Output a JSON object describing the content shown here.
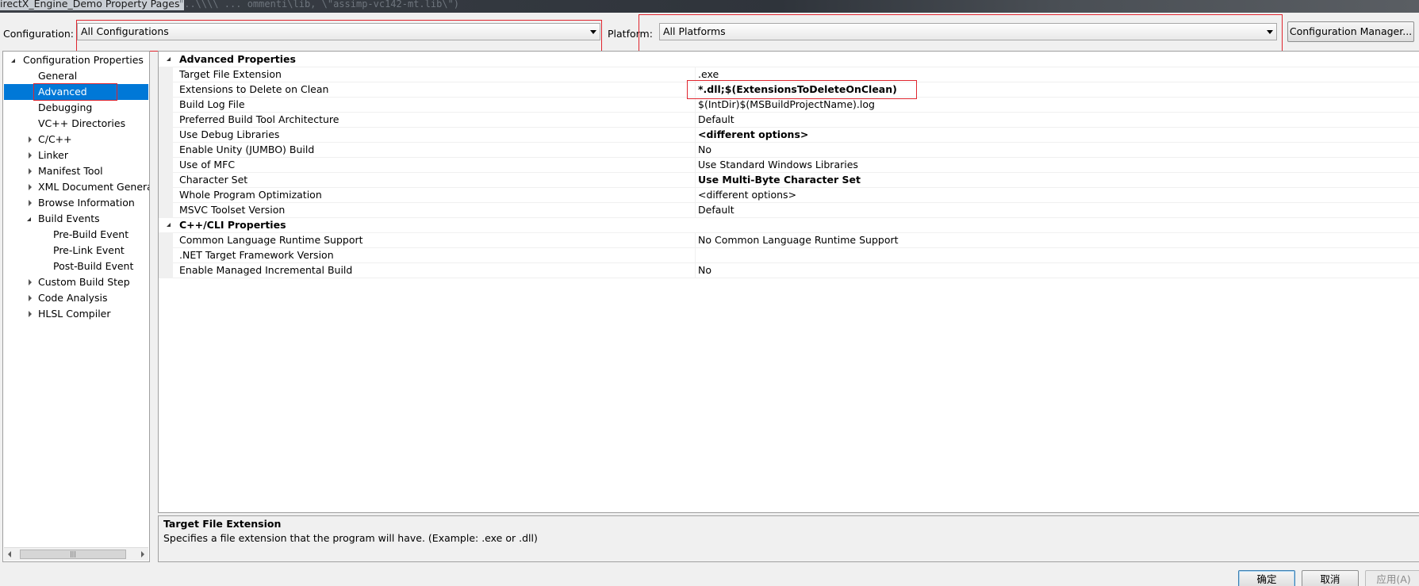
{
  "window": {
    "title": "irectX_Engine_Demo Property Pages",
    "ghost_text": "\"..\\\\\\\\ ... ommenti\\lib, \\\"assimp-vc142-mt.lib\\\")"
  },
  "toolbar": {
    "configuration_label": "Configuration:",
    "configuration_value": "All Configurations",
    "platform_label": "Platform:",
    "platform_value": "All Platforms",
    "config_manager_label": "Configuration Manager..."
  },
  "tree": {
    "items": [
      {
        "label": "Configuration Properties",
        "expander": "open"
      },
      {
        "label": "General",
        "expander": "none"
      },
      {
        "label": "Advanced",
        "expander": "none",
        "selected": true
      },
      {
        "label": "Debugging",
        "expander": "none"
      },
      {
        "label": "VC++ Directories",
        "expander": "none"
      },
      {
        "label": "C/C++",
        "expander": "closed"
      },
      {
        "label": "Linker",
        "expander": "closed"
      },
      {
        "label": "Manifest Tool",
        "expander": "closed"
      },
      {
        "label": "XML Document Generat",
        "expander": "closed"
      },
      {
        "label": "Browse Information",
        "expander": "closed"
      },
      {
        "label": "Build Events",
        "expander": "open"
      },
      {
        "label": "Pre-Build Event",
        "expander": "none"
      },
      {
        "label": "Pre-Link Event",
        "expander": "none"
      },
      {
        "label": "Post-Build Event",
        "expander": "none"
      },
      {
        "label": "Custom Build Step",
        "expander": "closed"
      },
      {
        "label": "Code Analysis",
        "expander": "closed"
      },
      {
        "label": "HLSL Compiler",
        "expander": "closed"
      }
    ],
    "scroll_thumb_glyph": "|||"
  },
  "grid": {
    "categories": [
      {
        "name": "Advanced Properties",
        "rows": [
          {
            "name": "Target File Extension",
            "value": ".exe",
            "bold": false
          },
          {
            "name": "Extensions to Delete on Clean",
            "value": "*.dll;$(ExtensionsToDeleteOnClean)",
            "bold": true
          },
          {
            "name": "Build Log File",
            "value": "$(IntDir)$(MSBuildProjectName).log",
            "bold": false
          },
          {
            "name": "Preferred Build Tool Architecture",
            "value": "Default",
            "bold": false
          },
          {
            "name": "Use Debug Libraries",
            "value": "<different options>",
            "bold": true
          },
          {
            "name": "Enable Unity (JUMBO) Build",
            "value": "No",
            "bold": false
          },
          {
            "name": "Use of MFC",
            "value": "Use Standard Windows Libraries",
            "bold": false
          },
          {
            "name": "Character Set",
            "value": "Use Multi-Byte Character Set",
            "bold": true
          },
          {
            "name": "Whole Program Optimization",
            "value": "<different options>",
            "bold": false
          },
          {
            "name": "MSVC Toolset Version",
            "value": "Default",
            "bold": false
          }
        ]
      },
      {
        "name": "C++/CLI Properties",
        "rows": [
          {
            "name": "Common Language Runtime Support",
            "value": "No Common Language Runtime Support",
            "bold": false
          },
          {
            "name": ".NET Target Framework Version",
            "value": "",
            "bold": false
          },
          {
            "name": "Enable Managed Incremental Build",
            "value": "No",
            "bold": false
          }
        ]
      }
    ]
  },
  "description": {
    "title": "Target File Extension",
    "text": "Specifies a file extension that the program will have. (Example: .exe or .dll)"
  },
  "buttons": {
    "ok": "确定",
    "cancel": "取消",
    "apply": "应用(A)"
  },
  "colors": {
    "selection": "#0078d7",
    "highlight_box": "#e0262f"
  }
}
